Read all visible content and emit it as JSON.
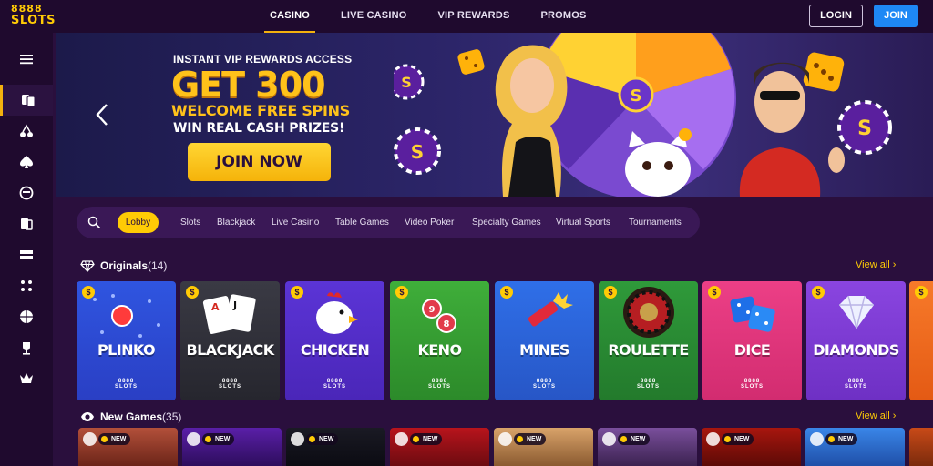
{
  "header": {
    "logo_line1": "8888",
    "logo_line2": "SLOTS",
    "nav": [
      "CASINO",
      "LIVE CASINO",
      "VIP REWARDS",
      "PROMOS"
    ],
    "login_label": "LOGIN",
    "join_label": "JOIN"
  },
  "sidebar": {
    "items": [
      "menu-icon",
      "cards-icon",
      "cherry-icon",
      "spade-icon",
      "dealer-icon",
      "playing-cards-icon",
      "table-game-icon",
      "dice-icon",
      "basketball-icon",
      "trophy-icon",
      "crown-icon"
    ]
  },
  "banner": {
    "subtitle": "INSTANT VIP REWARDS ACCESS",
    "headline": "GET 300",
    "offer": "WELCOME FREE SPINS",
    "tagline": "WIN REAL CASH PRIZES!",
    "cta": "JOIN NOW"
  },
  "categories": {
    "lobby": "Lobby",
    "items": [
      "Slots",
      "Blackjack",
      "Live Casino",
      "Table Games",
      "Video Poker",
      "Specialty Games",
      "Virtual Sports",
      "Tournaments"
    ]
  },
  "originals": {
    "title": "Originals",
    "count": "(14)",
    "view_all": "View all",
    "games": [
      "PLINKO",
      "BLACKJACK",
      "CHICKEN",
      "KENO",
      "MINES",
      "ROULETTE",
      "DICE",
      "DIAMONDS"
    ],
    "brand_line1": "8888",
    "brand_line2": "SLOTS",
    "coin": "$"
  },
  "new_games": {
    "title": "New Games",
    "count": "(35)",
    "view_all": "View all",
    "badge": "NEW"
  },
  "colors": {
    "accent": "#ffcb05",
    "background": "#2a0f3d",
    "join_button": "#1e88f5"
  }
}
